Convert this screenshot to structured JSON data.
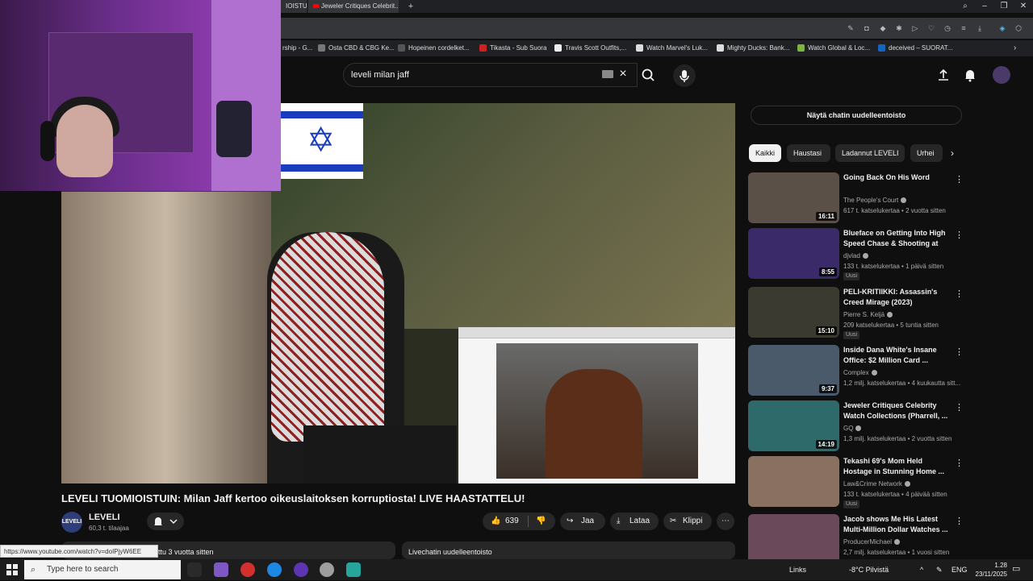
{
  "browser": {
    "tabs": [
      {
        "label": "IOISTUI!"
      },
      {
        "label": "Jeweler Critiques Celebrit..."
      }
    ],
    "new_tab": "+",
    "bookmarks": [
      {
        "label": "rship - G...",
        "color": "#888888"
      },
      {
        "label": "Osta CBD & CBG Ke...",
        "color": "#777777"
      },
      {
        "label": "Hopeinen cordelket...",
        "color": "#555555"
      },
      {
        "label": "Tikasta - Sub Suora",
        "color": "#cc2222"
      },
      {
        "label": "Travis Scott Outfits,...",
        "color": "#eeeeee"
      },
      {
        "label": "Watch Marvel's Luk...",
        "color": "#dddddd"
      },
      {
        "label": "Mighty Ducks: Bank...",
        "color": "#dddddd"
      },
      {
        "label": "Watch Global & Loc...",
        "color": "#7cb342"
      },
      {
        "label": "deceived – SUORAT...",
        "color": "#1565c0"
      }
    ]
  },
  "header": {
    "search_value": "leveli milan jaff"
  },
  "video": {
    "title": "LEVELI TUOMIOISTUIN: Milan Jaff kertoo oikeuslaitoksen korruptiosta! LIVE HAASTATTELU!",
    "channel": "LEVELI",
    "channel_avatar_text": "LEVELI",
    "subscribers": "60,3 t. tilaajaa",
    "likes": "639",
    "share_label": "Jaa",
    "download_label": "Lataa",
    "clip_label": "Klippi",
    "more_label": "⋯",
    "description_date": "ttu 3 vuotta sitten",
    "live_chat_label": "Livechatin uudelleentoisto"
  },
  "status_url": "https://www.youtube.com/watch?v=doIPjyW6EE",
  "sidebar": {
    "chat_replay_label": "Näytä chatin uudelleentoisto",
    "chips": [
      "Kaikki",
      "Haustasi",
      "Ladannut LEVELI",
      "Urhei"
    ],
    "recommendations": [
      {
        "title": "Going Back On His Word",
        "channel": "The People's Court",
        "meta": "617 t. katselukertaa • 2 vuotta sitten",
        "duration": "16:11",
        "badge": "",
        "thumb": "#5a5048"
      },
      {
        "title": "Blueface on Getting Into High Speed Chase & Shooting at M...",
        "channel": "djvlad",
        "meta": "133 t. katselukertaa • 1 päivä sitten",
        "duration": "8:55",
        "badge": "Uusi",
        "thumb": "#3a2a6a"
      },
      {
        "title": "PELI-KRITIIKKI: Assassin's Creed Mirage (2023)",
        "channel": "Pierre S. Keljä",
        "meta": "209 katselukertaa • 5 tuntia sitten",
        "duration": "15:10",
        "badge": "Uusi",
        "thumb": "#3a3a30"
      },
      {
        "title": "Inside Dana White's Insane Office: $2 Million Card ...",
        "channel": "Complex",
        "meta": "1,2 milj. katselukertaa • 4 kuukautta sitt...",
        "duration": "9:37",
        "badge": "",
        "thumb": "#4a5a6a"
      },
      {
        "title": "Jeweler Critiques Celebrity Watch Collections (Pharrell, ...",
        "channel": "GQ",
        "meta": "1,3 milj. katselukertaa • 2 vuotta sitten",
        "duration": "14:19",
        "badge": "",
        "thumb": "#2e6a6a"
      },
      {
        "title": "Tekashi 69's Mom Held Hostage in Stunning Home ...",
        "channel": "Law&Crime Network",
        "meta": "133 t. katselukertaa • 4 päivää sitten",
        "duration": "",
        "badge": "Uusi",
        "thumb": "#8a7060"
      },
      {
        "title": "Jacob shows Me His Latest Multi-Million Dollar Watches ...",
        "channel": "ProducerMichael",
        "meta": "2,7 milj. katselukertaa • 1 vuosi sitten",
        "duration": "",
        "badge": "",
        "thumb": "#6a4a5a"
      }
    ]
  },
  "taskbar": {
    "search_placeholder": "Type here to search",
    "links_label": "Links",
    "weather": "-8°C  Pilvistä",
    "lang": "ENG",
    "time": "1.28",
    "date": "23/11/2025"
  }
}
